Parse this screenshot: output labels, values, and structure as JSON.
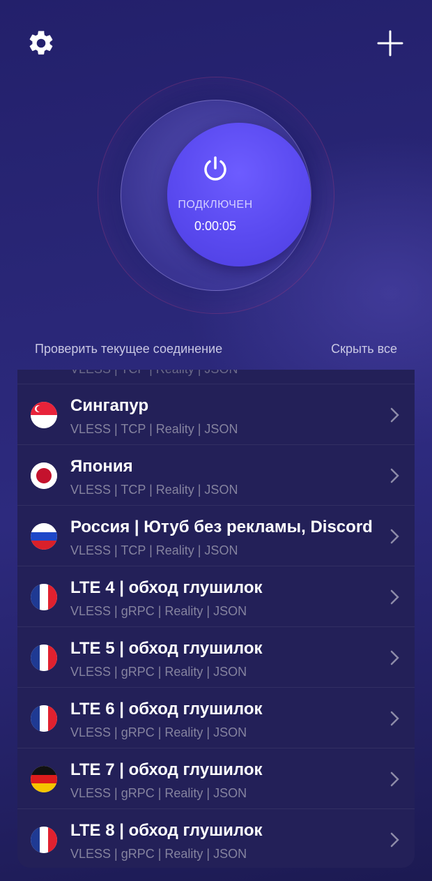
{
  "header": {
    "settings_icon": "gear-icon",
    "add_icon": "plus-icon"
  },
  "connection": {
    "status": "ПОДКЛЮЧЕН",
    "timer": "0:00:05",
    "power_icon": "power-icon",
    "accent": "#5a4af0"
  },
  "links": {
    "check": "Проверить текущее соединение",
    "hide": "Скрыть все"
  },
  "servers": {
    "partial_sub": "VLESS | TCP | Reality | JSON",
    "items": [
      {
        "name": "Сингапур",
        "sub": "VLESS | TCP | Reality | JSON",
        "flag": "singapore"
      },
      {
        "name": "Япония",
        "sub": "VLESS | TCP | Reality | JSON",
        "flag": "japan"
      },
      {
        "name": "Россия | Ютуб без рекламы, Discord",
        "sub": "VLESS | TCP | Reality | JSON",
        "flag": "russia"
      },
      {
        "name": "LTE 4 | обход глушилок",
        "sub": "VLESS | gRPC | Reality | JSON",
        "flag": "france"
      },
      {
        "name": "LTE 5 | обход глушилок",
        "sub": "VLESS | gRPC | Reality | JSON",
        "flag": "france"
      },
      {
        "name": "LTE 6 | обход глушилок",
        "sub": "VLESS | gRPC | Reality | JSON",
        "flag": "france"
      },
      {
        "name": "LTE 7 | обход глушилок",
        "sub": "VLESS | gRPC | Reality | JSON",
        "flag": "germany"
      },
      {
        "name": "LTE 8 | обход глушилок",
        "sub": "VLESS | gRPC | Reality | JSON",
        "flag": "france"
      }
    ]
  }
}
